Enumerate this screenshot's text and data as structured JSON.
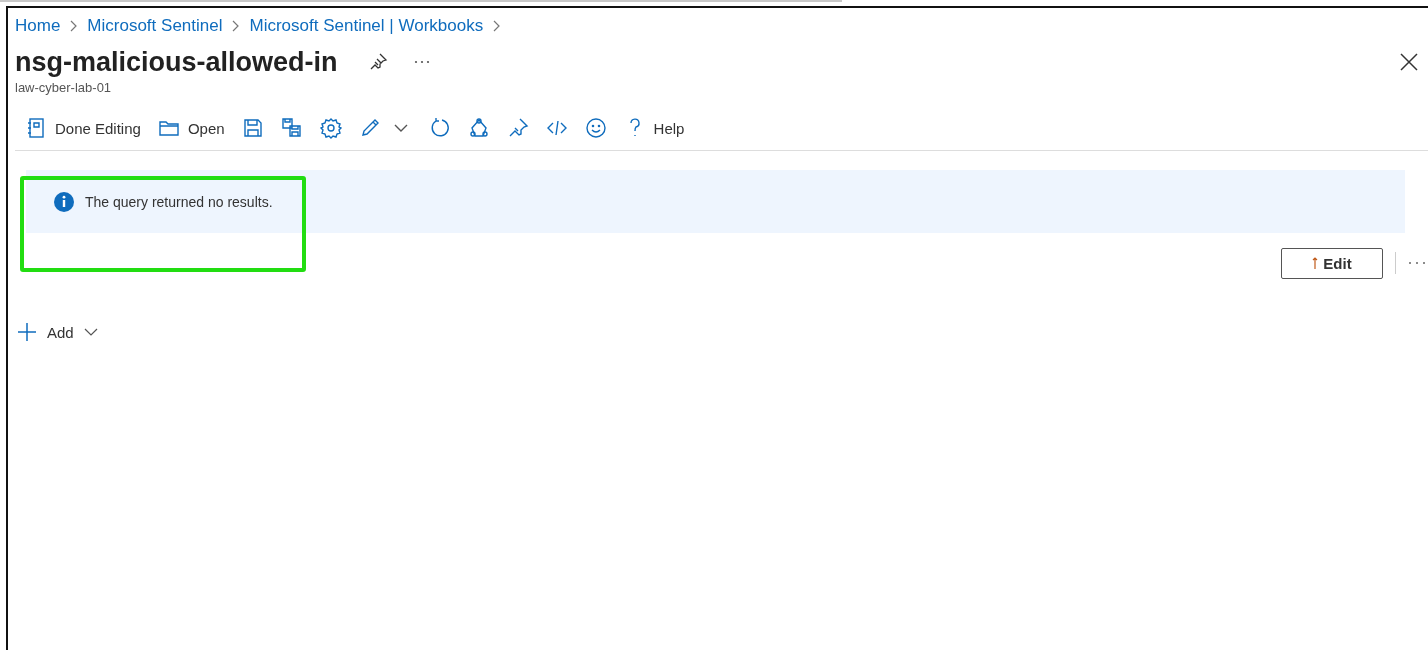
{
  "breadcrumb": [
    {
      "label": "Home"
    },
    {
      "label": "Microsoft Sentinel"
    },
    {
      "label": "Microsoft Sentinel | Workbooks"
    }
  ],
  "title": "nsg-malicious-allowed-in",
  "subtitle": "law-cyber-lab-01",
  "toolbar": [
    {
      "kind": "notebook",
      "label": "Done Editing"
    },
    {
      "kind": "folder",
      "label": "Open"
    },
    {
      "kind": "save"
    },
    {
      "kind": "saveas"
    },
    {
      "kind": "gear"
    },
    {
      "kind": "pencil"
    },
    {
      "kind": "caret"
    },
    {
      "kind": "refresh"
    },
    {
      "kind": "share"
    },
    {
      "kind": "pin"
    },
    {
      "kind": "code"
    },
    {
      "kind": "smiley"
    },
    {
      "kind": "help",
      "label": "Help"
    }
  ],
  "notice": {
    "text": "The query returned no results."
  },
  "edit_button": {
    "label": "Edit"
  },
  "add_button": {
    "label": "Add"
  }
}
